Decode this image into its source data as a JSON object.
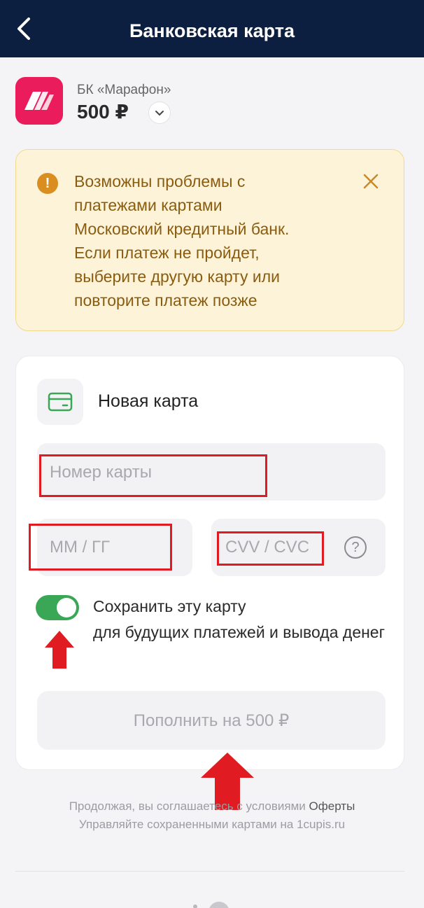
{
  "header": {
    "title": "Банковская карта"
  },
  "merchant": {
    "name": "БК «Марафон»",
    "amount": "500 ₽"
  },
  "alert": {
    "lines": [
      "Возможны проблемы с",
      "платежами картами",
      "Московский кредитный банк.",
      "Если платеж не пройдет,",
      "выберите другую карту или",
      "повторите платеж позже"
    ]
  },
  "payment_form": {
    "new_card_label": "Новая карта",
    "card_number_placeholder": "Номер карты",
    "expiry_placeholder": "ММ / ГГ",
    "cvv_placeholder": "CVV / CVC",
    "help_symbol": "?",
    "save_card": {
      "enabled": true,
      "title": "Сохранить эту карту",
      "description": "для будущих платежей и вывода денег"
    },
    "submit_label": "Пополнить на 500 ₽"
  },
  "footer": {
    "terms_prefix": "Продолжая, вы соглашаетесь с условиями ",
    "terms_link": "Оферты",
    "manage_text": "Управляйте сохраненными картами на 1cupis.ru"
  },
  "colors": {
    "header_bg": "#0c1f40",
    "brand": "#ea1c5c",
    "alert_bg": "#fdf3d9",
    "alert_text": "#8a5c10",
    "toggle_on": "#3aa757",
    "annotation_red": "#e11b22"
  }
}
